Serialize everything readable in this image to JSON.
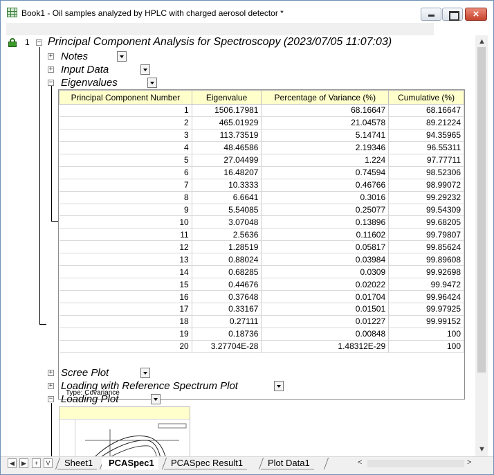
{
  "window": {
    "title": "Book1 - Oil samples analyzed by HPLC with charged aerosol detector *",
    "close_glyph": "×"
  },
  "report": {
    "row_number": "1",
    "title": "Principal Component Analysis for Spectroscopy (2023/07/05 11:07:03)",
    "sections": {
      "notes": "Notes",
      "input_data": "Input Data",
      "eigenvalues": "Eigenvalues",
      "scree_plot": "Scree Plot",
      "loading_ref": "Loading with Reference Spectrum Plot",
      "loading_plot": "Loading Plot"
    },
    "expander": {
      "collapsed": "+",
      "expanded": "−"
    }
  },
  "eigen_table": {
    "headers": [
      "Principal Component Number",
      "Eigenvalue",
      "Percentage of Variance (%)",
      "Cumulative (%)"
    ],
    "rows": [
      [
        "1",
        "1506.17981",
        "68.16647",
        "68.16647"
      ],
      [
        "2",
        "465.01929",
        "21.04578",
        "89.21224"
      ],
      [
        "3",
        "113.73519",
        "5.14741",
        "94.35965"
      ],
      [
        "4",
        "48.46586",
        "2.19346",
        "96.55311"
      ],
      [
        "5",
        "27.04499",
        "1.224",
        "97.77711"
      ],
      [
        "6",
        "16.48207",
        "0.74594",
        "98.52306"
      ],
      [
        "7",
        "10.3333",
        "0.46766",
        "98.99072"
      ],
      [
        "8",
        "6.6641",
        "0.3016",
        "99.29232"
      ],
      [
        "9",
        "5.54085",
        "0.25077",
        "99.54309"
      ],
      [
        "10",
        "3.07048",
        "0.13896",
        "99.68205"
      ],
      [
        "11",
        "2.5636",
        "0.11602",
        "99.79807"
      ],
      [
        "12",
        "1.28519",
        "0.05817",
        "99.85624"
      ],
      [
        "13",
        "0.88024",
        "0.03984",
        "99.89608"
      ],
      [
        "14",
        "0.68285",
        "0.0309",
        "99.92698"
      ],
      [
        "15",
        "0.44676",
        "0.02022",
        "99.9472"
      ],
      [
        "16",
        "0.37648",
        "0.01704",
        "99.96424"
      ],
      [
        "17",
        "0.33167",
        "0.01501",
        "99.97925"
      ],
      [
        "18",
        "0.27111",
        "0.01227",
        "99.99152"
      ],
      [
        "19",
        "0.18736",
        "0.00848",
        "100"
      ],
      [
        "20",
        "3.27704E-28",
        "1.48312E-29",
        "100"
      ]
    ],
    "note": "Type: Covariance"
  },
  "scroll": {
    "up": "▲",
    "down": "▼",
    "left": "<",
    "right": ">"
  },
  "sheet_nav": [
    "◀",
    "▶",
    "+",
    "V"
  ],
  "sheet_tabs": [
    "Sheet1",
    "PCASpec1",
    "PCASpec Result1",
    "Plot Data1"
  ]
}
